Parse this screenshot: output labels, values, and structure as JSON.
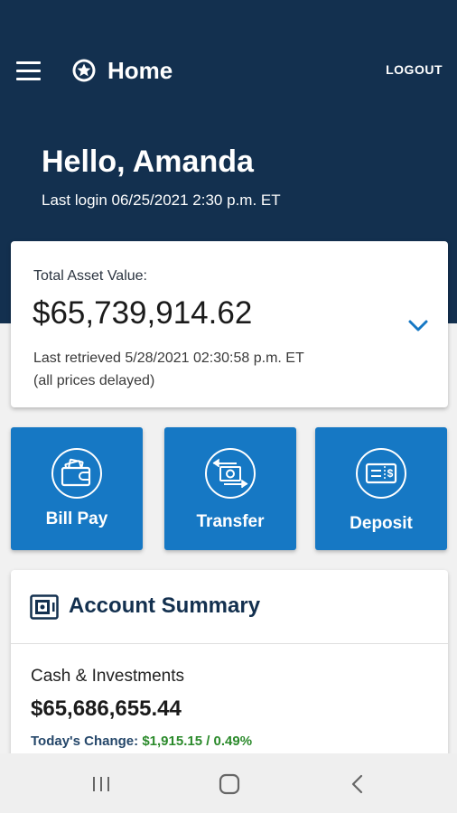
{
  "app": {
    "title": "Home",
    "logout_label": "LOGOUT",
    "icons": {
      "menu": "hamburger-menu-icon",
      "logo": "star-badge-logo"
    }
  },
  "greeting": {
    "text": "Hello, Amanda",
    "last_login": "Last login 06/25/2021 2:30 p.m. ET"
  },
  "assets": {
    "label": "Total Asset Value:",
    "value": "$65,739,914.62",
    "retrieved": "Last retrieved 5/28/2021 02:30:58 p.m. ET",
    "delay_note": "(all prices delayed)"
  },
  "actions": [
    {
      "label": "Bill Pay",
      "icon": "wallet-icon"
    },
    {
      "label": "Transfer",
      "icon": "transfer-icon"
    },
    {
      "label": "Deposit",
      "icon": "check-deposit-icon"
    }
  ],
  "summary": {
    "title": "Account Summary",
    "icon": "safe-icon",
    "cash_label": "Cash & Investments",
    "cash_value": "$65,686,655.44",
    "change_label": "Today's Change:",
    "change_value": "$1,915.15 / 0.49%"
  },
  "colors": {
    "header_bg": "#13304f",
    "action_bg": "#1678c4",
    "positive": "#2b8a2b"
  }
}
